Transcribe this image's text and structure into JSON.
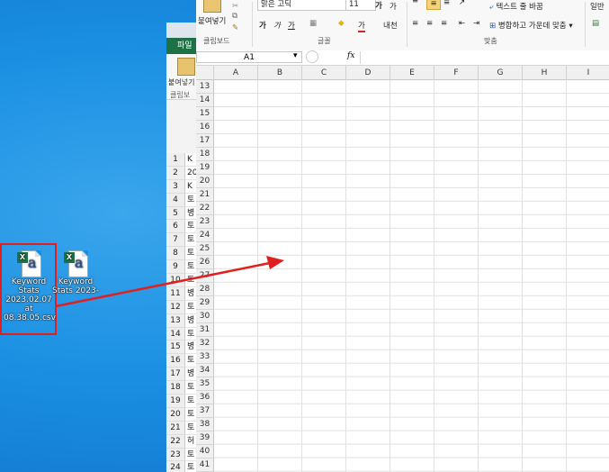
{
  "desktop": {
    "icons": [
      {
        "label_lines": [
          "Keyword",
          "Stats",
          "2023.02.07",
          "at",
          "08.38.05.csv"
        ],
        "icon": "excel-csv-file-icon",
        "selected": true
      },
      {
        "label_lines": [
          "Keyword",
          "Stats 2023-"
        ],
        "icon": "excel-csv-file-icon",
        "selected": false
      }
    ],
    "annotation_color": "#e0201e"
  },
  "back_window": {
    "tab_file": "파일",
    "paste_label": "붙여넣기",
    "clipboard_label": "클립보",
    "rows": [
      {
        "n": "1",
        "v": "K"
      },
      {
        "n": "2",
        "v": "20"
      },
      {
        "n": "3",
        "v": "K"
      },
      {
        "n": "4",
        "v": "토"
      },
      {
        "n": "5",
        "v": "병"
      },
      {
        "n": "6",
        "v": "토"
      },
      {
        "n": "7",
        "v": "토"
      },
      {
        "n": "8",
        "v": "토"
      },
      {
        "n": "9",
        "v": "토"
      },
      {
        "n": "10",
        "v": "토"
      },
      {
        "n": "11",
        "v": "병"
      },
      {
        "n": "12",
        "v": "토"
      },
      {
        "n": "13",
        "v": "병"
      },
      {
        "n": "14",
        "v": "토"
      },
      {
        "n": "15",
        "v": "병"
      },
      {
        "n": "16",
        "v": "토"
      },
      {
        "n": "17",
        "v": "병"
      },
      {
        "n": "18",
        "v": "토"
      },
      {
        "n": "19",
        "v": "토"
      },
      {
        "n": "20",
        "v": "토"
      },
      {
        "n": "21",
        "v": "토"
      },
      {
        "n": "22",
        "v": "허"
      },
      {
        "n": "23",
        "v": "토"
      },
      {
        "n": "24",
        "v": "토"
      }
    ]
  },
  "ribbon": {
    "paste_label": "붙여넣기",
    "clipboard_group": "클립보드",
    "font_name": "맑은 고딕",
    "font_size": "11",
    "grow_font": "가",
    "shrink_font": "가",
    "bold": "가",
    "italic": "가",
    "underline": "가",
    "font_color_glyph": "가",
    "phonetic": "내천",
    "font_group": "글꼴",
    "wrap_text": "텍스트 줄 바꿈",
    "merge_center": "병합하고 가운데 맞춤",
    "alignment_group": "맞춤",
    "number_format": "일반"
  },
  "formula_bar": {
    "name_box": "A1",
    "fx": "fx",
    "value": ""
  },
  "sheet": {
    "columns": [
      "A",
      "B",
      "C",
      "D",
      "E",
      "F",
      "G",
      "H",
      "I"
    ],
    "rows": [
      "13",
      "14",
      "15",
      "16",
      "17",
      "18",
      "19",
      "20",
      "21",
      "22",
      "23",
      "24",
      "25",
      "26",
      "27",
      "28",
      "29",
      "30",
      "31",
      "32",
      "33",
      "34",
      "35",
      "36",
      "37",
      "38",
      "39",
      "40",
      "41"
    ]
  }
}
